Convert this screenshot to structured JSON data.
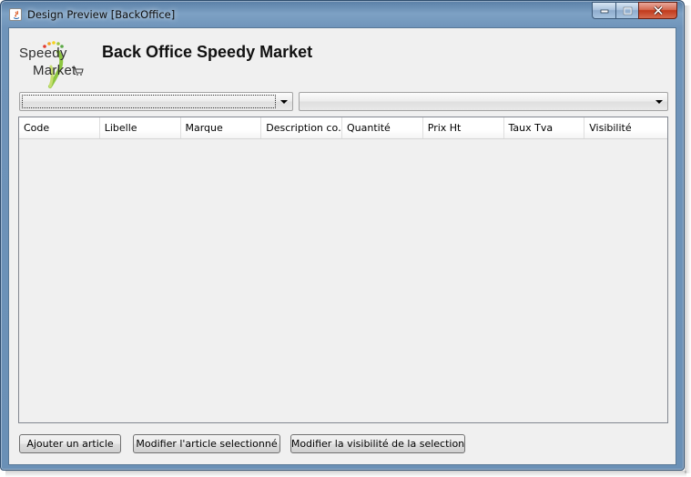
{
  "window": {
    "title": "Design Preview [BackOffice]",
    "controls": {
      "minimize_icon": "minimize-icon",
      "maximize_icon": "maximize-icon",
      "close_icon": "close-icon"
    }
  },
  "logo": {
    "line1": "Speedy",
    "line2": "Market"
  },
  "header": {
    "title": "Back Office Speedy Market"
  },
  "filters": {
    "combo1": {
      "value": ""
    },
    "combo2": {
      "value": ""
    }
  },
  "table": {
    "columns": [
      "Code",
      "Libelle",
      "Marque",
      "Description co…",
      "Quantité",
      "Prix Ht",
      "Taux Tva",
      "Visibilité"
    ],
    "rows": []
  },
  "buttons": {
    "add": "Ajouter un article",
    "edit": "Modifier l'article selectionné",
    "visibility": "Modifier la visibilité de la selection"
  },
  "colors": {
    "title_bar": "#6f94ba",
    "close_button": "#c0391b",
    "client_bg": "#f0f0f0"
  }
}
